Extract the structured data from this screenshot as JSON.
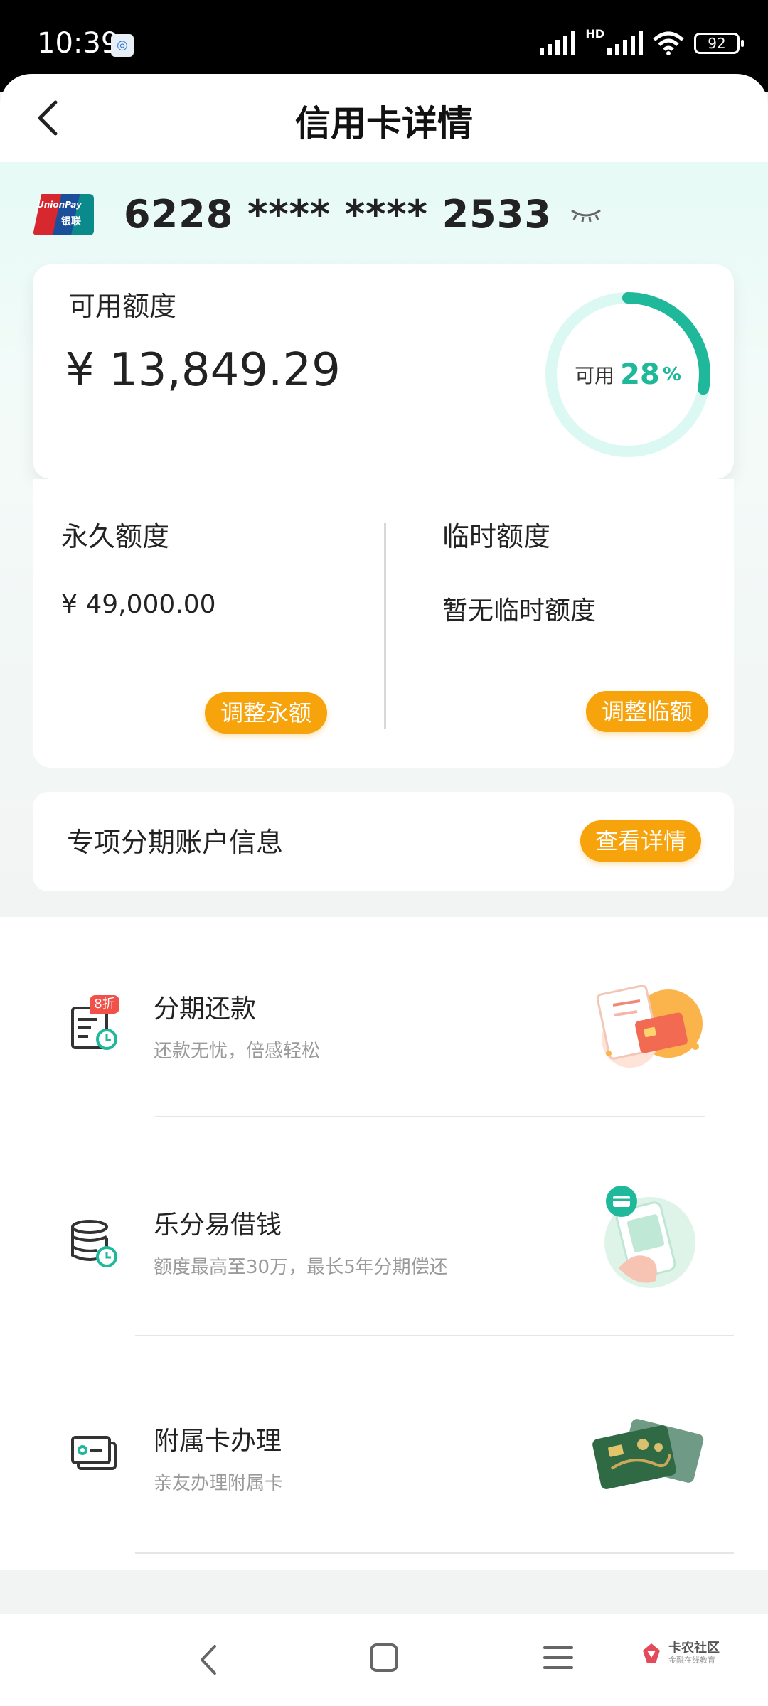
{
  "status_bar": {
    "time": "10:39",
    "battery": "92",
    "network_badge": "HD",
    "notification_icon": "location-app-icon"
  },
  "header": {
    "title": "信用卡详情",
    "back_icon": "chevron-left-icon"
  },
  "card": {
    "brand_logo": "unionpay-logo",
    "brand_text_en": "UnionPay",
    "brand_text_cn": "银联",
    "masked_number": "6228 **** **** 2533",
    "visibility_icon": "eye-closed-icon"
  },
  "available": {
    "label": "可用额度",
    "amount": "¥ 13,849.29",
    "ring_label": "可用",
    "ring_percent": "28",
    "ring_percent_sign": "%",
    "ring_fraction": 0.28,
    "ring_color": "#1fb89a",
    "ring_track_color": "#dbf9f2"
  },
  "limits": {
    "permanent": {
      "title": "永久额度",
      "value": "¥ 49,000.00",
      "button": "调整永额"
    },
    "temporary": {
      "title": "临时额度",
      "value": "暂无临时额度",
      "button": "调整临额"
    }
  },
  "installment_account": {
    "title": "专项分期账户信息",
    "button": "查看详情"
  },
  "services": [
    {
      "title": "分期还款",
      "subtitle": "还款无忧，倍感轻松",
      "icon": "bill-clock-icon",
      "badge": "8折",
      "illustration": "receipt-card-illustration"
    },
    {
      "title": "乐分易借钱",
      "subtitle": "额度最高至30万，最长5年分期偿还",
      "icon": "coins-clock-icon",
      "illustration": "phone-hand-illustration"
    },
    {
      "title": "附属卡办理",
      "subtitle": "亲友办理附属卡",
      "icon": "cards-icon",
      "illustration": "bank-cards-illustration"
    }
  ],
  "nav": {
    "back_icon": "nav-back-icon",
    "home_icon": "nav-home-icon",
    "menu_icon": "nav-menu-icon"
  },
  "watermark": {
    "title": "卡农社区",
    "subtitle": "金融在线教育"
  },
  "colors": {
    "accent": "#1fb89a",
    "button_orange": "#f7a30c"
  }
}
